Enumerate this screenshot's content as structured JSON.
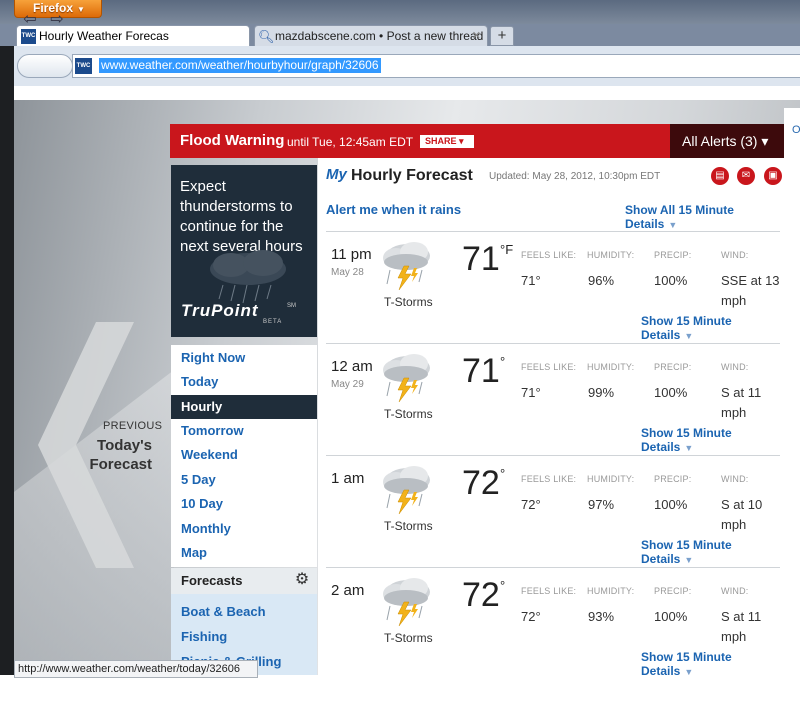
{
  "browser": {
    "app_button": "Firefox",
    "tabs": [
      {
        "label": "Hourly Weather Forecas",
        "favicon": "TWC"
      },
      {
        "label": "mazdabscene.com • Post a new thread"
      }
    ],
    "new_tab": "+",
    "url_favicon": "TWC",
    "url": "www.weather.com/weather/hourbyhour/graph/32606",
    "status_url": "http://www.weather.com/weather/today/32606"
  },
  "alert": {
    "title": "Flood Warning",
    "until": "until Tue, 12:45am EDT",
    "share": "SHARE ▾",
    "all_alerts": "All Alerts (3) ▾"
  },
  "promo": {
    "text": "Expect thunderstorms to continue for the next several hours",
    "brand": "TruPoint",
    "brand_sup": "SM",
    "brand_beta": "BETA"
  },
  "left_nav": [
    "Right Now",
    "Today",
    "Hourly",
    "Tomorrow",
    "Weekend",
    "5 Day",
    "10 Day",
    "Monthly",
    "Map"
  ],
  "left_nav_active": "Hourly",
  "forecasts": {
    "header": "Forecasts",
    "items": [
      "Boat & Beach",
      "Fishing",
      "Picnic & Grilling"
    ]
  },
  "previous": {
    "label": "PREVIOUS",
    "title_line1": "Today's",
    "title_line2": "Forecast"
  },
  "main": {
    "logo": "My",
    "title": "Hourly Forecast",
    "updated": "Updated: May 28, 2012, 10:30pm EDT",
    "alert_me": "Alert me when it rains",
    "show_all": "Show All 15 Minute Details",
    "labels": {
      "feels": "FEELS LIKE:",
      "humidity": "HUMIDITY:",
      "precip": "PRECIP:",
      "wind": "WIND:"
    },
    "detail_link": "Show 15 Minute Details",
    "rows": [
      {
        "time": "11 pm",
        "date": "May 28",
        "condition": "T-Storms",
        "temp": "71",
        "unit": "°F",
        "feels": "71°",
        "humidity": "96%",
        "precip": "100%",
        "wind": "SSE at 13 mph"
      },
      {
        "time": "12 am",
        "date": "May 29",
        "condition": "T-Storms",
        "temp": "71",
        "unit": "°",
        "feels": "71°",
        "humidity": "99%",
        "precip": "100%",
        "wind": "S at 11 mph"
      },
      {
        "time": "1 am",
        "date": "",
        "condition": "T-Storms",
        "temp": "72",
        "unit": "°",
        "feels": "72°",
        "humidity": "97%",
        "precip": "100%",
        "wind": "S at 10 mph"
      },
      {
        "time": "2 am",
        "date": "",
        "condition": "T-Storms",
        "temp": "72",
        "unit": "°",
        "feels": "72°",
        "humidity": "93%",
        "precip": "100%",
        "wind": "S at 11 mph"
      }
    ]
  },
  "colors": {
    "alert_red": "#c9161c",
    "link_blue": "#1b64b1",
    "panel_dark": "#1f2d3a"
  }
}
